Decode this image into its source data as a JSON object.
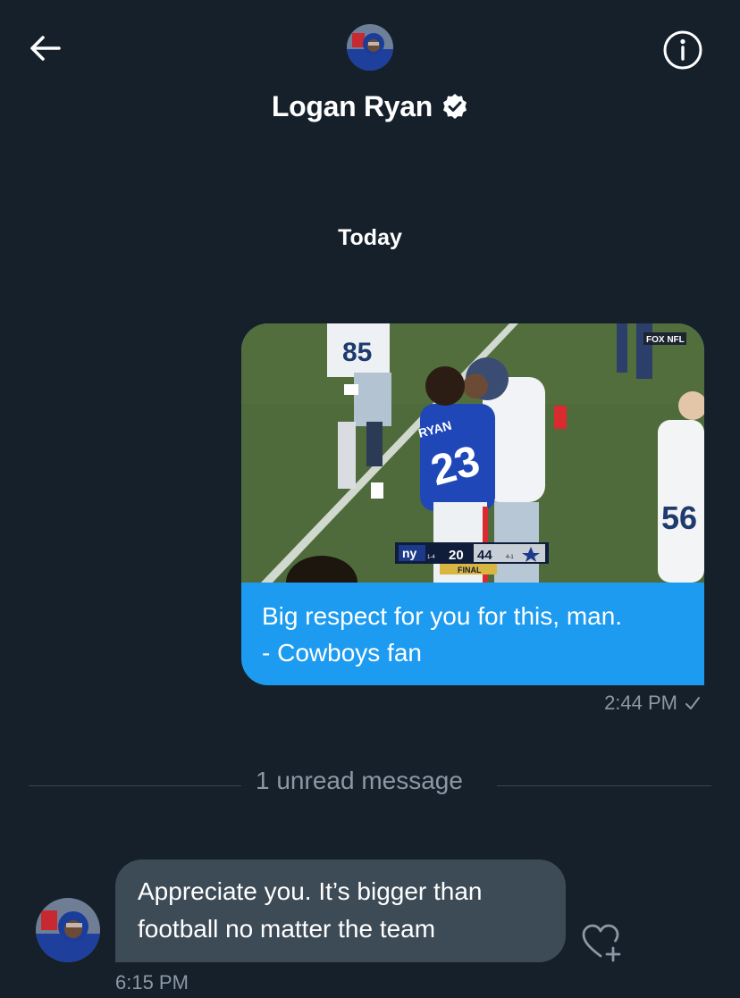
{
  "header": {
    "title": "Logan Ryan",
    "back_icon": "arrow-left-icon",
    "info_icon": "info-circle-icon",
    "verified_icon": "verified-badge-icon"
  },
  "conversation": {
    "day_label": "Today",
    "divider_text": "1 unread message"
  },
  "messages": [
    {
      "direction": "outgoing",
      "image": {
        "scoreboard": {
          "team_left": "ny",
          "record_left": "1-4",
          "score_left": "20",
          "score_right": "44",
          "record_right": "4-1",
          "status": "FINAL"
        },
        "broadcaster": "FOX NFL",
        "jersey_name": "RYAN",
        "jersey_number": "23",
        "other_numbers": [
          "85",
          "56"
        ]
      },
      "text": "Big respect for you for this, man.\n- Cowboys fan",
      "time": "2:44 PM",
      "status_icon": "checkmark-icon"
    },
    {
      "direction": "incoming",
      "text": "Appreciate you. It’s bigger than football no matter the team",
      "time": "6:15 PM",
      "reaction_icon": "heart-plus-icon"
    }
  ],
  "colors": {
    "background": "#15202b",
    "outgoing_bubble": "#1d9bf0",
    "incoming_bubble": "#3d4b57",
    "muted_text": "#8b98a5",
    "field_green": "#4f6b3b"
  }
}
